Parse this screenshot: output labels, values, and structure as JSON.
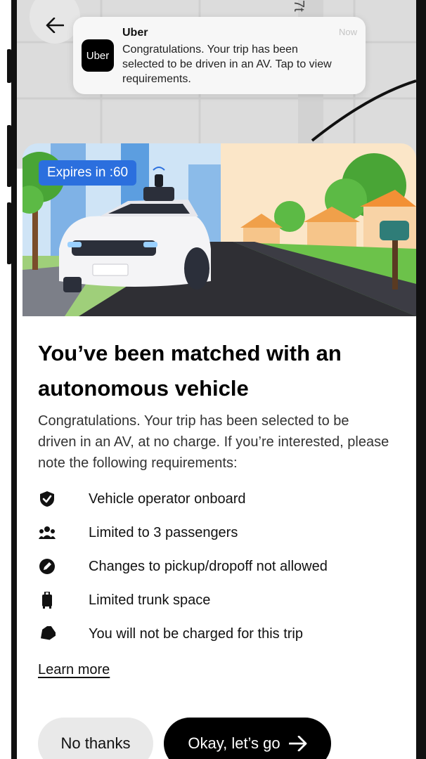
{
  "notification": {
    "app_name": "Uber",
    "logo_text": "Uber",
    "time": "Now",
    "message": "Congratulations. Your trip has been selected to be driven in an AV. Tap to view requirements."
  },
  "map": {
    "street_label": "7t"
  },
  "hero": {
    "expires_label": "Expires in :60"
  },
  "offer": {
    "title": "You’ve been matched with an autonomous vehicle",
    "description": "Congratulations. Your trip has been selected to be driven in an AV, at no charge. If you’re interested, please note the following requirements:",
    "requirements": [
      {
        "icon": "shield-check-icon",
        "label": "Vehicle operator onboard"
      },
      {
        "icon": "passengers-icon",
        "label": "Limited to 3 passengers"
      },
      {
        "icon": "no-edit-icon",
        "label": "Changes to pickup/dropoff not allowed"
      },
      {
        "icon": "luggage-icon",
        "label": "Limited trunk space"
      },
      {
        "icon": "tag-icon",
        "label": "You will not be charged for this trip"
      }
    ],
    "learn_more": "Learn more"
  },
  "actions": {
    "decline_label": "No thanks",
    "accept_label": "Okay, let’s go"
  },
  "colors": {
    "accent_blue": "#2b6fde",
    "primary_button": "#000000",
    "secondary_button": "#e9e9e9"
  }
}
